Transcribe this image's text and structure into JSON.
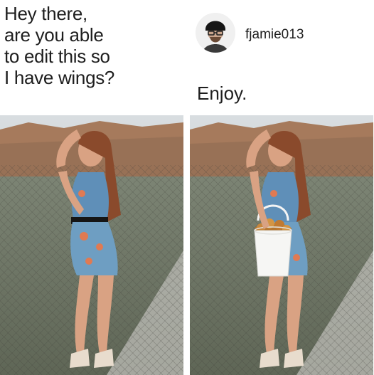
{
  "request": {
    "lines": [
      "Hey there,",
      "are you able",
      "to edit this so",
      "I have wings?"
    ]
  },
  "reply": {
    "username": "fjamie013",
    "avatar_icon": "user-avatar-icon",
    "text": "Enjoy."
  },
  "photos": {
    "left": {
      "icon": "woman-photo"
    },
    "right": {
      "icon": "woman-with-bucket-photo"
    }
  },
  "colors": {
    "text": "#1e1e1e",
    "background": "#ffffff"
  }
}
